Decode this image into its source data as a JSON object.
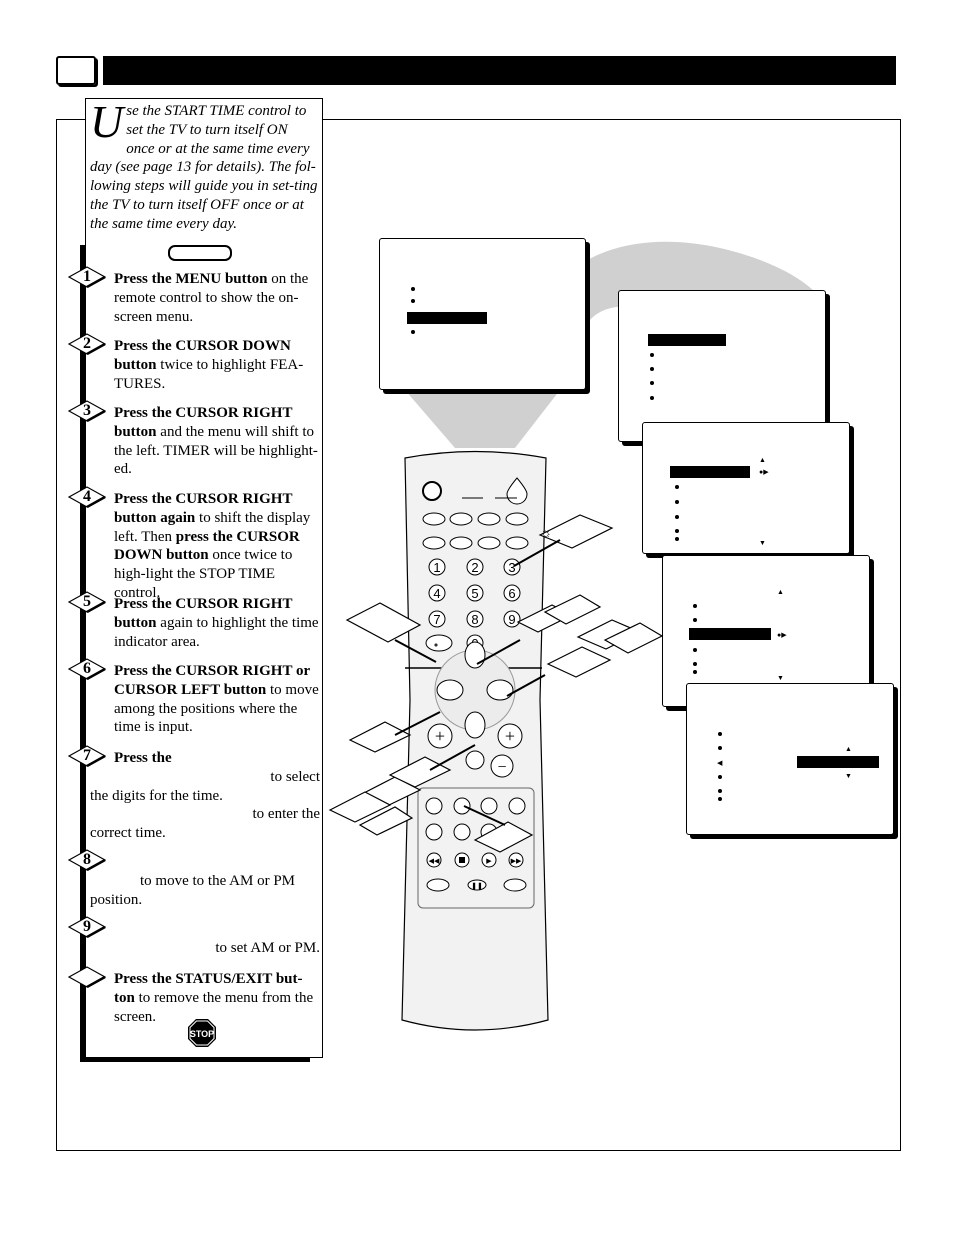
{
  "header": {
    "page_number": ""
  },
  "intro": {
    "dropcap": "U",
    "text": "se the START TIME control to set the TV to turn itself ON once or at the same time every day (see page 13  for details).  The fol-lowing steps will guide you in set-ting the TV to turn itself OFF once or at the same time every day."
  },
  "steps": [
    {
      "num": "1",
      "lines": [
        {
          "align": "left",
          "segs": [
            {
              "b": true,
              "t": "Press the MENU button"
            },
            {
              "b": false,
              "t": " on the remote control to show the on-screen menu."
            }
          ]
        }
      ]
    },
    {
      "num": "2",
      "lines": [
        {
          "align": "left",
          "segs": [
            {
              "b": true,
              "t": "Press the CURSOR DOWN button"
            },
            {
              "b": false,
              "t": " twice to highlight FEA-TURES."
            }
          ]
        }
      ]
    },
    {
      "num": "3",
      "lines": [
        {
          "align": "left",
          "segs": [
            {
              "b": true,
              "t": "Press the CURSOR RIGHT button"
            },
            {
              "b": false,
              "t": " and the menu will shift to the left. TIMER will be highlight-ed."
            }
          ]
        }
      ]
    },
    {
      "num": "4",
      "lines": [
        {
          "align": "left",
          "segs": [
            {
              "b": true,
              "t": "Press the CURSOR RIGHT button again"
            },
            {
              "b": false,
              "t": " to shift the display left. Then "
            },
            {
              "b": true,
              "t": "press the CURSOR DOWN button"
            },
            {
              "b": false,
              "t": " once twice to high-light the STOP TIME control."
            }
          ]
        }
      ]
    },
    {
      "num": "5",
      "lines": [
        {
          "align": "left",
          "segs": [
            {
              "b": true,
              "t": "Press the CURSOR RIGHT button"
            },
            {
              "b": false,
              "t": " again to highlight the time indicator area."
            }
          ]
        }
      ]
    },
    {
      "num": "6",
      "lines": [
        {
          "align": "left",
          "segs": [
            {
              "b": true,
              "t": "Press the CURSOR RIGHT or CURSOR LEFT button"
            },
            {
              "b": false,
              "t": " to move among the positions where the time is input."
            }
          ]
        }
      ]
    },
    {
      "num": "7",
      "lines": [
        {
          "align": "first",
          "segs": [
            {
              "b": true,
              "t": "Press the"
            }
          ]
        },
        {
          "align": "right",
          "segs": [
            {
              "b": false,
              "t": "to select"
            }
          ]
        },
        {
          "align": "left",
          "segs": [
            {
              "b": false,
              "t": "the digits for the time."
            }
          ]
        },
        {
          "align": "right",
          "segs": [
            {
              "b": false,
              "t": "to enter the"
            }
          ]
        },
        {
          "align": "left",
          "segs": [
            {
              "b": false,
              "t": "correct time."
            }
          ]
        }
      ]
    },
    {
      "num": "8",
      "lines": [
        {
          "align": "first",
          "segs": [
            {
              "b": false,
              "t": " "
            }
          ]
        },
        {
          "align": "pad",
          "segs": [
            {
              "b": false,
              "t": "to move to the AM or PM"
            }
          ]
        },
        {
          "align": "left",
          "segs": [
            {
              "b": false,
              "t": "position."
            }
          ]
        }
      ]
    },
    {
      "num": "9",
      "lines": [
        {
          "align": "first",
          "segs": [
            {
              "b": false,
              "t": " "
            }
          ]
        },
        {
          "align": "right",
          "segs": [
            {
              "b": false,
              "t": "to set AM or PM."
            }
          ]
        }
      ]
    },
    {
      "num": "",
      "lines": [
        {
          "align": "left",
          "segs": [
            {
              "b": true,
              "t": "Press the STATUS/EXIT but-ton"
            },
            {
              "b": false,
              "t": " to remove the menu from the screen."
            }
          ]
        }
      ]
    }
  ],
  "stop_sign": {
    "text": "STOP",
    "color": "#000000"
  },
  "remote": {
    "digits": [
      "1",
      "2",
      "3",
      "4",
      "5",
      "6",
      "7",
      "8",
      "9",
      "0"
    ],
    "plus": "+",
    "minus": "−"
  },
  "colors": {
    "beam": "#d0d0d0",
    "remote_body": "#f2f2f2",
    "ink": "#000000"
  }
}
